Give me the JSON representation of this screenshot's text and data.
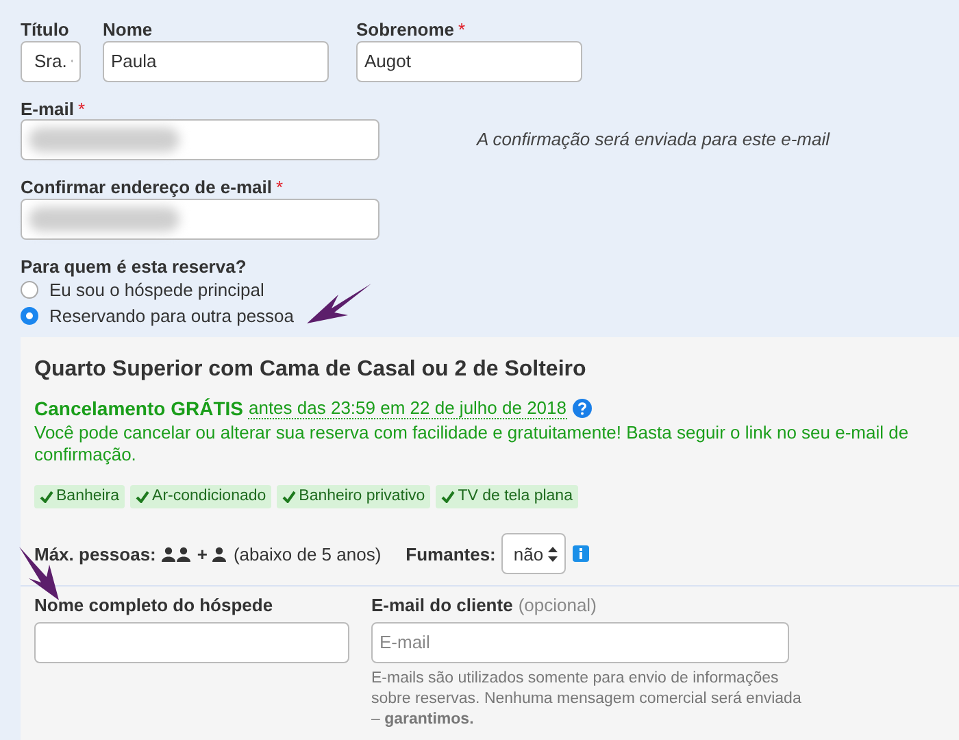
{
  "guest_details": {
    "fields": [
      {
        "kind": "select",
        "label": "Título",
        "value": "Sra."
      },
      {
        "kind": "text",
        "label": "Nome",
        "value": "Paula"
      },
      {
        "kind": "text",
        "label": "Sobrenome",
        "value": "Augot",
        "required_mark": "*"
      }
    ],
    "email": {
      "label": "E-mail",
      "required_mark": "*",
      "hint": "A confirmação será enviada para este e-mail"
    },
    "confirm_email": {
      "label": "Confirmar endereço de e-mail",
      "required_mark": "*"
    },
    "booking_for": {
      "question": "Para quem é esta reserva?",
      "options": [
        {
          "label": "Eu sou o hóspede principal",
          "selected": false
        },
        {
          "label": "Reservando para outra pessoa",
          "selected": true
        }
      ]
    }
  },
  "room": {
    "title": "Quarto Superior com Cama de Casal ou 2 de Solteiro",
    "cancellation": {
      "label": "Cancelamento GRÁTIS",
      "deadline": "antes das 23:59 em 22 de julho de 2018",
      "description": "Você pode cancelar ou alterar sua reserva com facilidade e gratuitamente! Basta seguir o link no seu e-mail de confirmação."
    },
    "amenities": [
      "Banheira",
      "Ar-condicionado",
      "Banheiro privativo",
      "TV de tela plana"
    ],
    "max_guests": {
      "label": "Máx. pessoas:",
      "plus": "+",
      "note": "(abaixo de 5 anos)"
    },
    "smoking": {
      "label": "Fumantes:",
      "value": "não"
    },
    "guest_form": {
      "name_label": "Nome completo do hóspede",
      "email_label": "E-mail do cliente",
      "email_optional": "(opcional)",
      "email_placeholder": "E-mail",
      "email_help": "E-mails são utilizados somente para envio de informações sobre reservas. Nenhuma mensagem comercial será enviada – **garantimos.**"
    }
  }
}
